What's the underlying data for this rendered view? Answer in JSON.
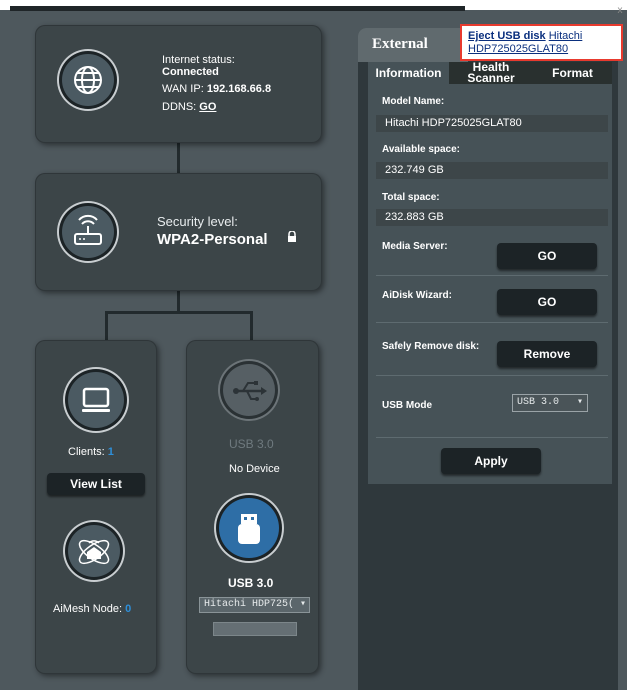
{
  "internet": {
    "status_label": "Internet status:",
    "status_value": "Connected",
    "wan_label": "WAN IP:",
    "wan_ip": "192.168.66.8",
    "ddns_label": "DDNS:",
    "ddns_link": "GO"
  },
  "security": {
    "label": "Security level:",
    "value": "WPA2-Personal",
    "lock_glyph": "🔒"
  },
  "clients": {
    "label": "Clients:",
    "count": "1",
    "view_list": "View List"
  },
  "aimesh": {
    "label": "AiMesh Node:",
    "count": "0"
  },
  "usb_empty": {
    "title": "USB 3.0",
    "status": "No Device"
  },
  "usb_device": {
    "title": "USB 3.0",
    "selected_disk": "Hitachi HDP725("
  },
  "panel": {
    "title": "External",
    "tabs": [
      {
        "label": "Information"
      },
      {
        "label": "Health\nScanner"
      },
      {
        "label": "Format"
      }
    ],
    "model_label": "Model Name:",
    "model_value": "Hitachi HDP725025GLAT80",
    "avail_label": "Available space:",
    "avail_value": "232.749 GB",
    "total_label": "Total space:",
    "total_value": "232.883 GB",
    "media_label": "Media Server:",
    "media_btn": "GO",
    "aidisk_label": "AiDisk Wizard:",
    "aidisk_btn": "GO",
    "remove_label": "Safely Remove disk:",
    "remove_btn": "Remove",
    "usbmode_label": "USB Mode",
    "usbmode_value": "USB 3.0",
    "apply_btn": "Apply"
  },
  "tooltip": {
    "title": "Eject USB disk",
    "disk": "Hitachi HDP725025GLAT80",
    "close": "x"
  },
  "colors": {
    "accent_blue": "#2e8fd9",
    "highlight_red": "#e83a2e"
  }
}
